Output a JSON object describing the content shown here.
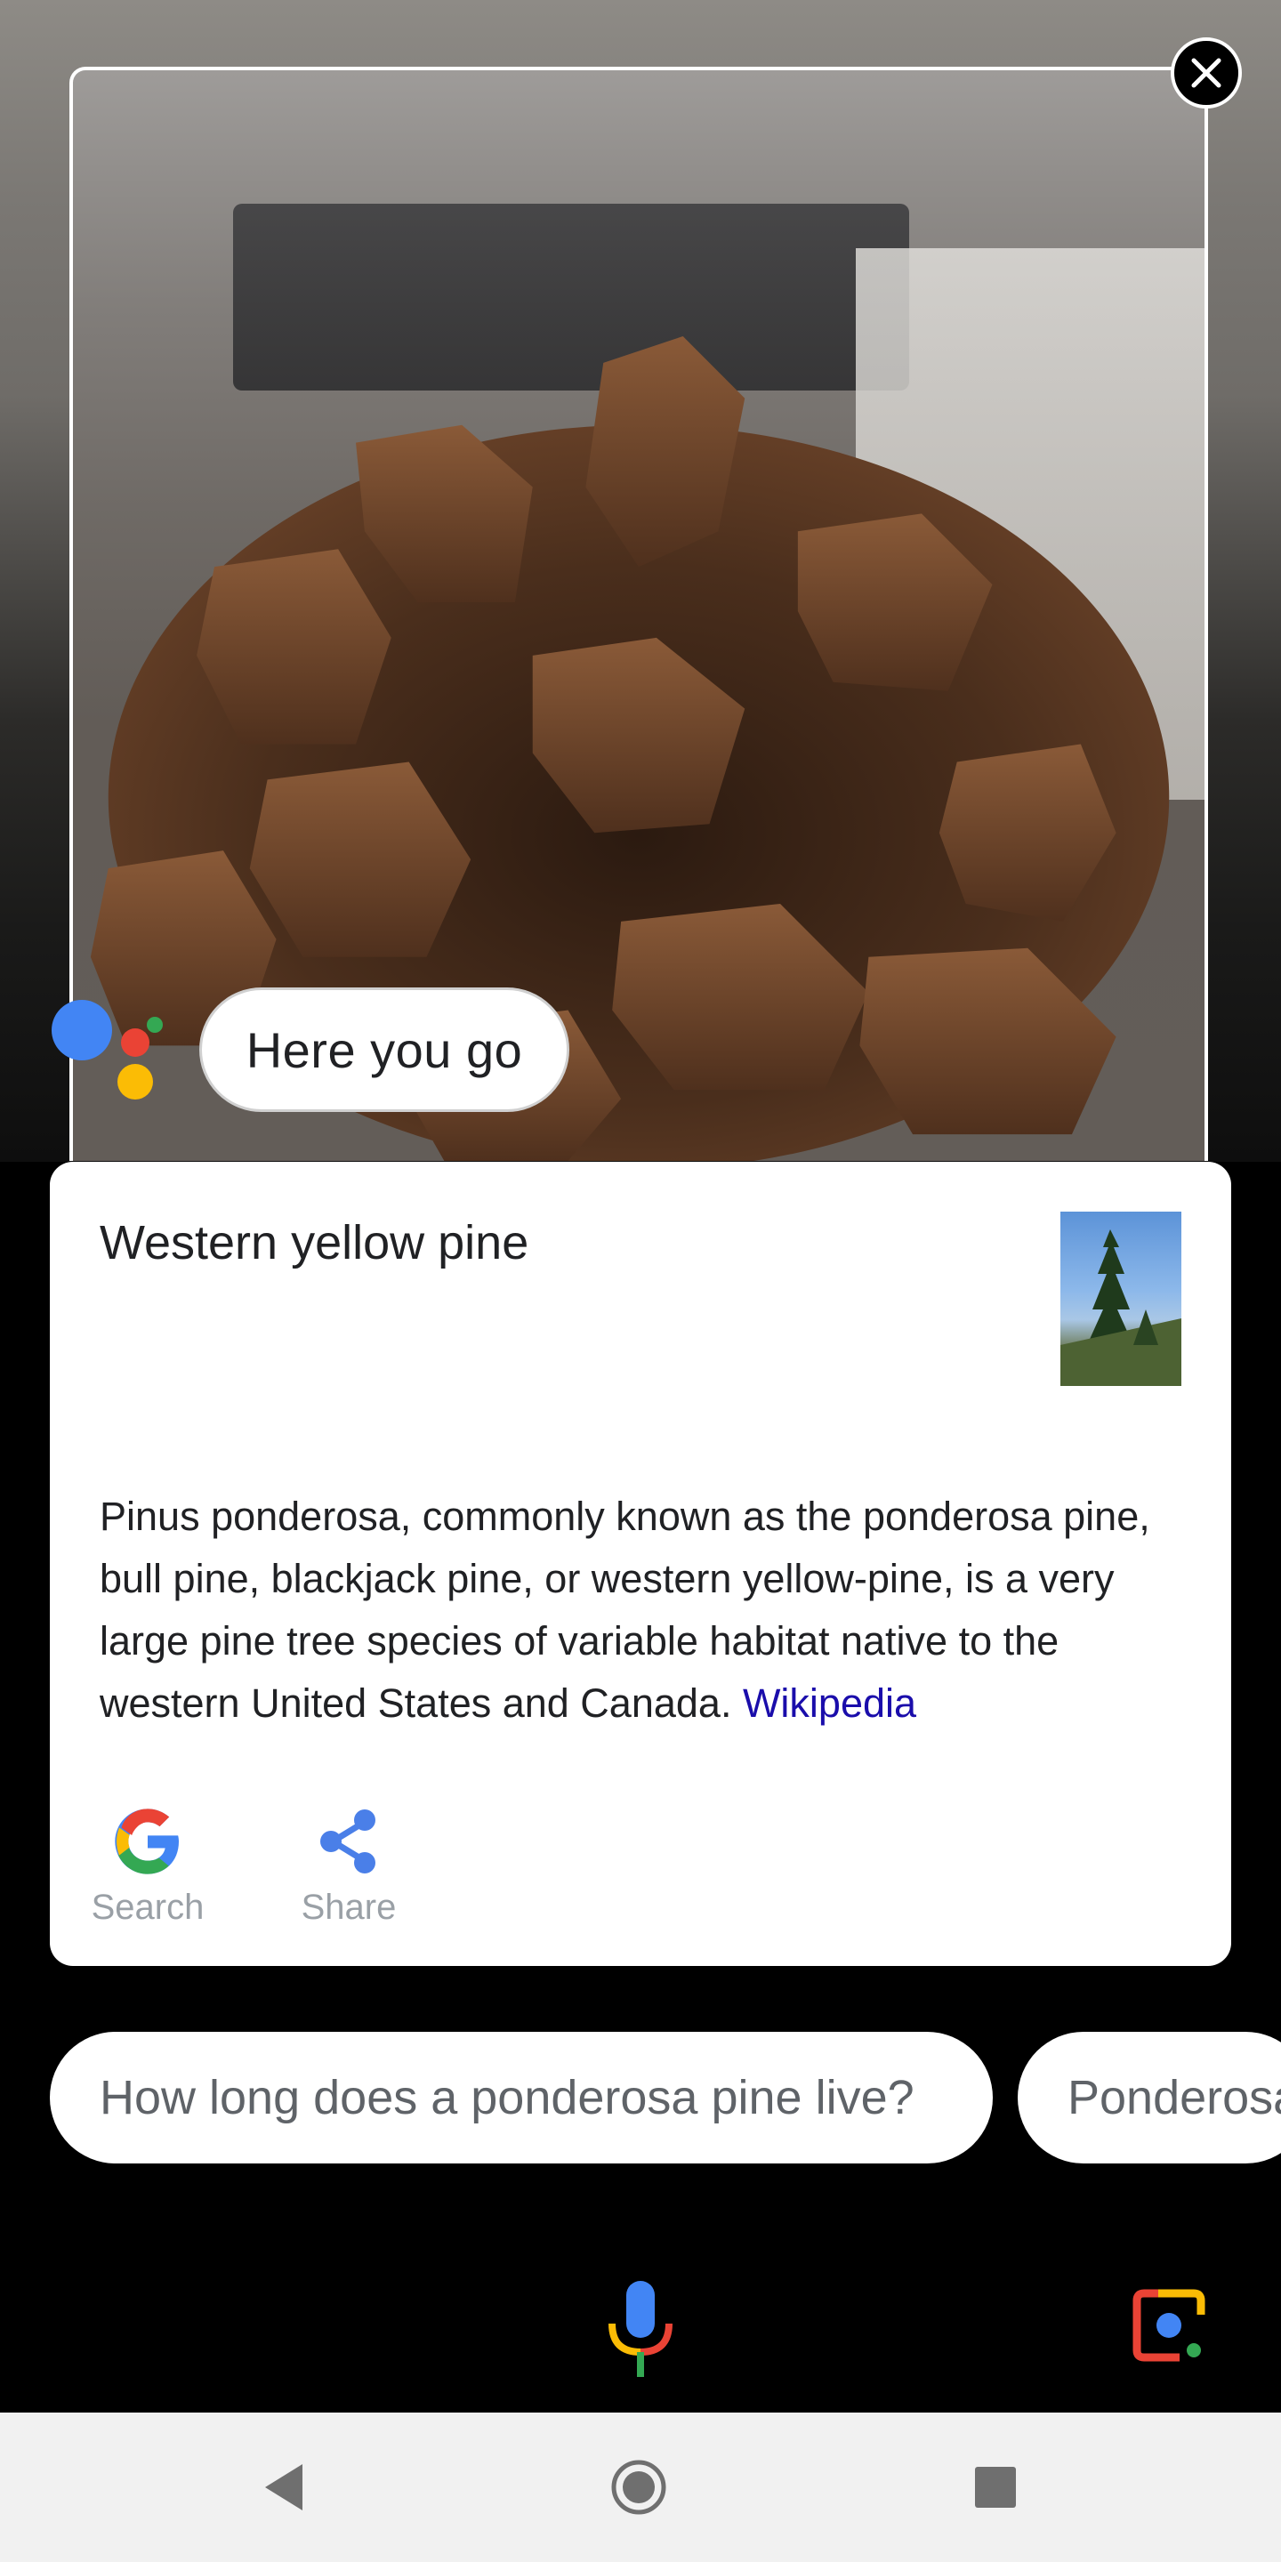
{
  "assistant": {
    "response": "Here you go"
  },
  "card": {
    "title": "Western yellow pine",
    "description": "Pinus ponderosa, commonly known as the ponderosa pine, bull pine, blackjack pine, or western yellow-pine, is a very large pine tree species of variable habitat native to the western United States and Canada.",
    "source_link": "Wikipedia",
    "actions": [
      {
        "label": "Search",
        "icon": "google-g-icon"
      },
      {
        "label": "Share",
        "icon": "share-icon"
      }
    ]
  },
  "suggestions": [
    "How long does a ponderosa pine live?",
    "Ponderosa"
  ],
  "colors": {
    "google_blue": "#4285F4",
    "google_red": "#EA4335",
    "google_yellow": "#FBBC05",
    "google_green": "#34A853",
    "link": "#1a0dab"
  },
  "icons": {
    "close": "close-icon",
    "mic": "mic-icon",
    "lens": "google-lens-icon",
    "nav_back": "back-icon",
    "nav_home": "home-icon",
    "nav_recent": "recent-apps-icon"
  }
}
